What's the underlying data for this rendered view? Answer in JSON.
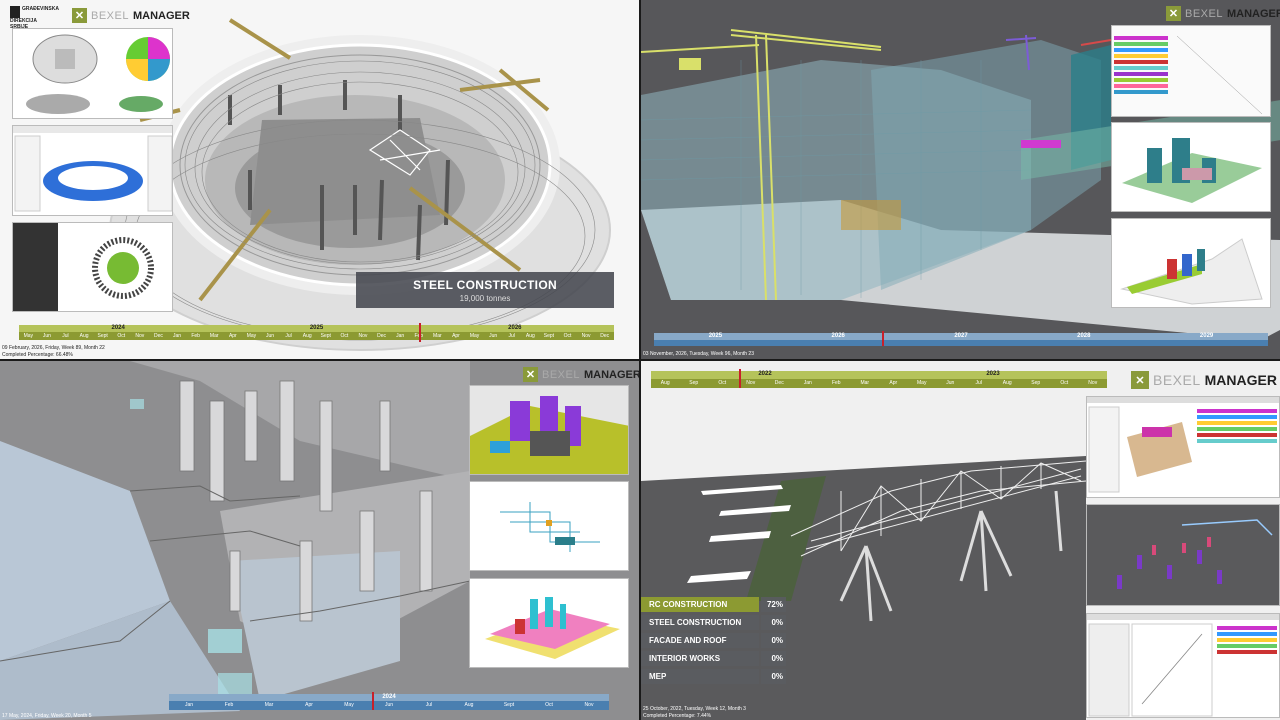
{
  "brand": {
    "part1": "BEXEL",
    "part2": "MANAGER"
  },
  "client_logo": {
    "line1": "GRAĐEVINSKA",
    "line2": "DIREKCIJA",
    "line3": "SRBIJE"
  },
  "q1": {
    "overlay_title": "STEEL CONSTRUCTION",
    "overlay_subtitle": "19,000 tonnes",
    "timeline_years": [
      "2024",
      "2025",
      "2026"
    ],
    "timeline_months": [
      "May",
      "Jun",
      "Jul",
      "Aug",
      "Sept",
      "Oct",
      "Nov",
      "Dec",
      "Jan",
      "Feb",
      "Mar",
      "Apr",
      "May",
      "Jun",
      "Jul",
      "Aug",
      "Sept",
      "Oct",
      "Nov",
      "Dec",
      "Jan",
      "Feb",
      "Mar",
      "Apr",
      "May",
      "Jun",
      "Jul",
      "Aug",
      "Sept",
      "Oct",
      "Nov",
      "Dec"
    ],
    "status_date": "09 February, 2026, Friday, Week 89, Month 22",
    "status_pct": "Completed Percentage: 66.48%"
  },
  "q2": {
    "timeline_years": [
      "2025",
      "2026",
      "2027",
      "2028",
      "2029"
    ],
    "status_date": "03 November, 2026, Tuesday, Week 96, Month 23"
  },
  "q3": {
    "timeline_year": "2024",
    "timeline_months": [
      "Jan",
      "Feb",
      "Mar",
      "Apr",
      "May",
      "Jun",
      "Jul",
      "Aug",
      "Sept",
      "Oct",
      "Nov"
    ],
    "status_date": "17 May, 2024, Friday, Week 20, Month 5"
  },
  "q4": {
    "timeline_years": [
      "2022",
      "2023"
    ],
    "timeline_months": [
      "Aug",
      "Sep",
      "Oct",
      "Nov",
      "Dec",
      "Jan",
      "Feb",
      "Mar",
      "Apr",
      "May",
      "Jun",
      "Jul",
      "Aug",
      "Sep",
      "Oct",
      "Nov"
    ],
    "status_date": "25 October, 2022, Tuesday, Week 12, Month 3",
    "status_pct": "Completed Percentage: 7.44%",
    "phases": [
      {
        "label": "RC CONSTRUCTION",
        "value": "72%"
      },
      {
        "label": "STEEL CONSTRUCTION",
        "value": "0%"
      },
      {
        "label": "FACADE AND ROOF",
        "value": "0%"
      },
      {
        "label": "INTERIOR WORKS",
        "value": "0%"
      },
      {
        "label": "MEP",
        "value": "0%"
      }
    ]
  }
}
